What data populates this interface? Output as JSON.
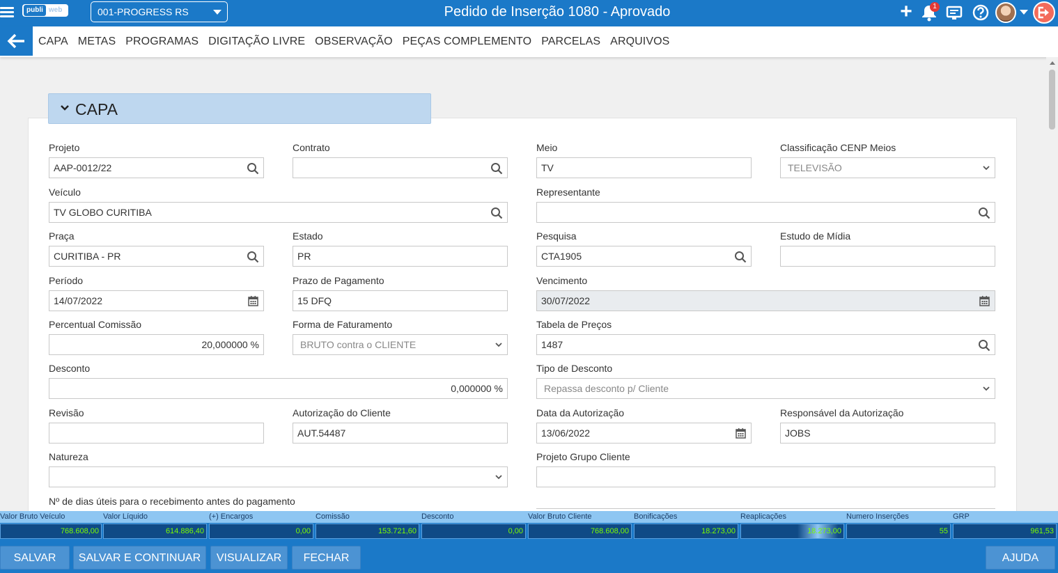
{
  "header": {
    "logo_part1": "publi",
    "logo_part2": "web",
    "company": "001-PROGRESS RS",
    "title": "Pedido de Inserção 1080 - Aprovado",
    "notification_count": "1"
  },
  "tabs": [
    "CAPA",
    "METAS",
    "PROGRAMAS",
    "DIGITAÇÃO LIVRE",
    "OBSERVAÇÃO",
    "PEÇAS COMPLEMENTO",
    "PARCELAS",
    "ARQUIVOS"
  ],
  "section": {
    "title": "CAPA"
  },
  "form": {
    "projeto": {
      "label": "Projeto",
      "value": "AAP-0012/22"
    },
    "contrato": {
      "label": "Contrato",
      "value": ""
    },
    "meio": {
      "label": "Meio",
      "value": "TV"
    },
    "classificacao": {
      "label": "Classificação CENP Meios",
      "value": "TELEVISÃO"
    },
    "veiculo": {
      "label": "Veículo",
      "value": "TV GLOBO CURITIBA"
    },
    "representante": {
      "label": "Representante",
      "value": ""
    },
    "praca": {
      "label": "Praça",
      "value": "CURITIBA - PR"
    },
    "estado": {
      "label": "Estado",
      "value": "PR"
    },
    "pesquisa": {
      "label": "Pesquisa",
      "value": "CTA1905"
    },
    "estudo": {
      "label": "Estudo de Mídia",
      "value": ""
    },
    "periodo": {
      "label": "Período",
      "value": "14/07/2022"
    },
    "prazo": {
      "label": "Prazo de Pagamento",
      "value": "15 DFQ"
    },
    "vencimento": {
      "label": "Vencimento",
      "value": "30/07/2022"
    },
    "percentual": {
      "label": "Percentual Comissão",
      "value": "20,000000 %"
    },
    "forma": {
      "label": "Forma de Faturamento",
      "value": "BRUTO contra o CLIENTE"
    },
    "tabela": {
      "label": "Tabela de Preços",
      "value": "1487"
    },
    "desconto": {
      "label": "Desconto",
      "value": "0,000000 %"
    },
    "tipo_desconto": {
      "label": "Tipo de Desconto",
      "value": "Repassa desconto p/ Cliente"
    },
    "revisao": {
      "label": "Revisão",
      "value": ""
    },
    "autorizacao": {
      "label": "Autorização do Cliente",
      "value": "AUT.54487"
    },
    "data_autorizacao": {
      "label": "Data da Autorização",
      "value": "13/06/2022"
    },
    "responsavel": {
      "label": "Responsável da Autorização",
      "value": "JOBS"
    },
    "natureza": {
      "label": "Natureza",
      "value": ""
    },
    "projeto_grupo": {
      "label": "Projeto Grupo Cliente",
      "value": ""
    },
    "dias_uteis": {
      "label": "Nº de dias úteis para o recebimento antes do pagamento"
    }
  },
  "totals": [
    {
      "label": "Valor Bruto Veículo",
      "value": "768.608,00"
    },
    {
      "label": "Valor Líquido",
      "value": "614.886,40"
    },
    {
      "label": "(+) Encargos",
      "value": "0,00"
    },
    {
      "label": "Comissão",
      "value": "153.721,60"
    },
    {
      "label": "Desconto",
      "value": "0,00"
    },
    {
      "label": "Valor Bruto Cliente",
      "value": "768.608,00"
    },
    {
      "label": "Bonificações",
      "value": "18.273,00"
    },
    {
      "label": "Reaplicações",
      "value": "18.273,00"
    },
    {
      "label": "Numero Inserções",
      "value": "55"
    },
    {
      "label": "GRP",
      "value": "961,53"
    }
  ],
  "buttons": {
    "salvar": "SALVAR",
    "salvar_continuar": "SALVAR E CONTINUAR",
    "visualizar": "VISUALIZAR",
    "fechar": "FECHAR",
    "ajuda": "AJUDA"
  },
  "colors": {
    "primary": "#1b79c8",
    "section_header": "#bed7ef",
    "total_value": "#7CFC00"
  }
}
